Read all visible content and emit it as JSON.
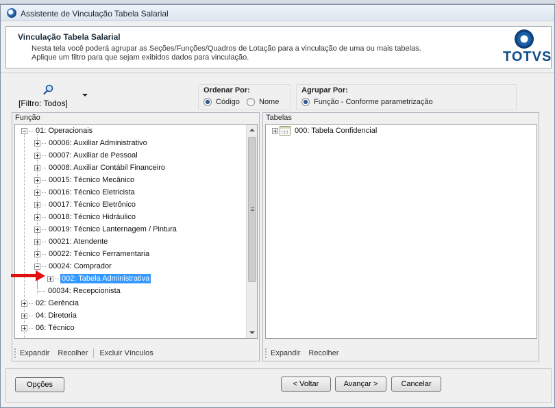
{
  "window": {
    "title": "Assistente de Vinculação Tabela Salarial"
  },
  "header": {
    "title": "Vinculação Tabela Salarial",
    "description_line1": "Nesta tela você poderá agrupar as Seções/Funções/Quadros de Lotação para a vinculação de uma ou mais tabelas.",
    "description_line2": "Aplique um filtro para que sejam exibidos dados para vinculação.",
    "logo_text": "TOTVS"
  },
  "filter": {
    "label": "[Filtro: Todos]"
  },
  "ordenar": {
    "title": "Ordenar Por:",
    "options": [
      {
        "label": "Código",
        "selected": true
      },
      {
        "label": "Nome",
        "selected": false
      }
    ]
  },
  "agrupar": {
    "title": "Agrupar Por:",
    "options": [
      {
        "label": "Função - Conforme parametrização",
        "selected": true
      }
    ]
  },
  "funcao_panel": {
    "title": "Função",
    "nodes": [
      {
        "label": "01: Operacionais",
        "toggle": "minus"
      },
      {
        "label": "00006: Auxiliar Administrativo",
        "toggle": "plus"
      },
      {
        "label": "00007: Auxiliar de Pessoal",
        "toggle": "plus"
      },
      {
        "label": "00008: Auxiliar Contábil Financeiro",
        "toggle": "plus"
      },
      {
        "label": "00015: Técnico Mecânico",
        "toggle": "plus"
      },
      {
        "label": "00016: Técnico Eletricista",
        "toggle": "plus"
      },
      {
        "label": "00017: Técnico Eletrônico",
        "toggle": "plus"
      },
      {
        "label": "00018: Técnico Hidráulico",
        "toggle": "plus"
      },
      {
        "label": "00019: Técnico Lanternagem / Pintura",
        "toggle": "plus"
      },
      {
        "label": "00021: Atendente",
        "toggle": "plus"
      },
      {
        "label": "00022: Técnico Ferramentaria",
        "toggle": "plus"
      },
      {
        "label": "00024: Comprador",
        "toggle": "minus"
      },
      {
        "label": "002: Tabela Administrativa",
        "toggle": "plus",
        "selected": true
      },
      {
        "label": "00034: Recepcionista",
        "toggle": "none"
      },
      {
        "label": "02: Gerência",
        "toggle": "plus"
      },
      {
        "label": "04: Diretoria",
        "toggle": "plus"
      },
      {
        "label": "06: Técnico",
        "toggle": "plus"
      }
    ],
    "toolbar": {
      "expandir": "Expandir",
      "recolher": "Recolher",
      "excluir": "Excluir Vínculos"
    }
  },
  "tabelas_panel": {
    "title": "Tabelas",
    "nodes": [
      {
        "label": "000: Tabela Confidencial",
        "toggle": "plus"
      }
    ],
    "toolbar": {
      "expandir": "Expandir",
      "recolher": "Recolher"
    }
  },
  "buttons": {
    "opcoes": "Opções",
    "voltar": "< Voltar",
    "avancar": "Avançar >",
    "cancelar": "Cancelar"
  },
  "colors": {
    "selection": "#3399ff",
    "arrow": "#e01010",
    "brand": "#0f4c8a"
  }
}
